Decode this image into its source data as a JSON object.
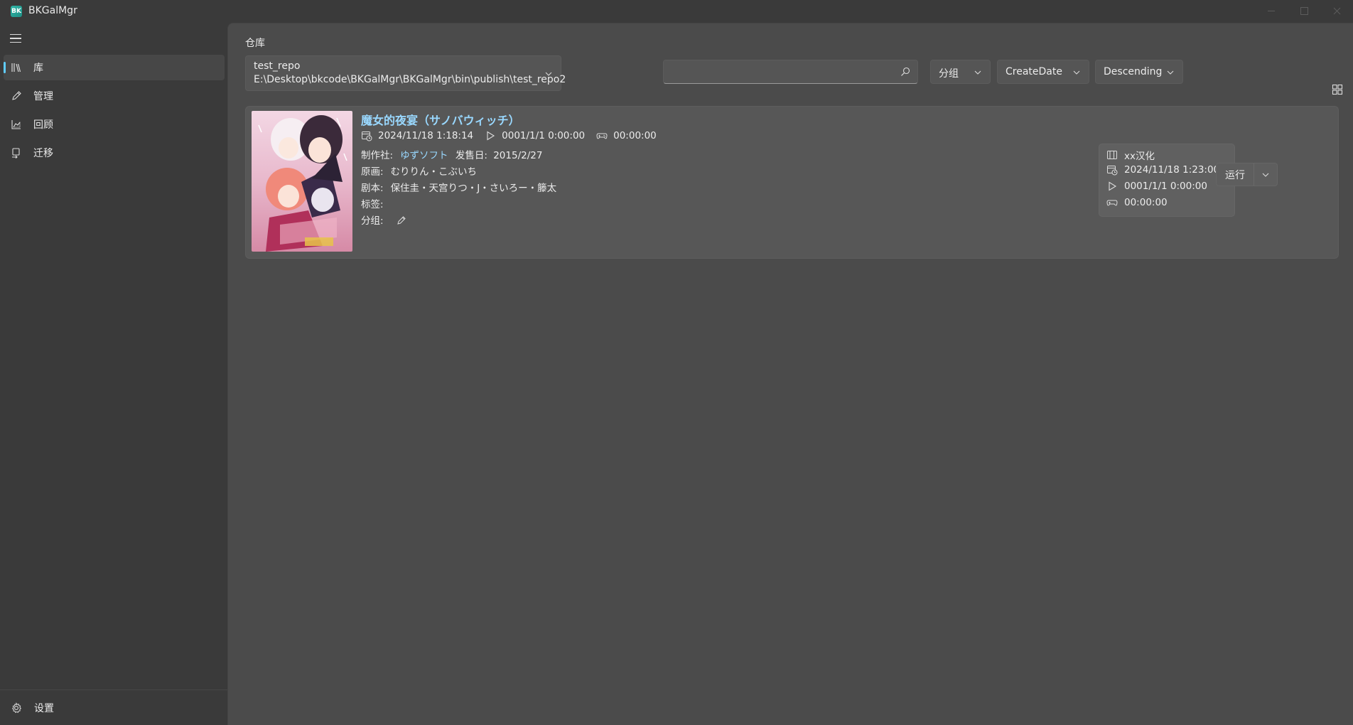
{
  "titlebar": {
    "app_title": "BKGalMgr",
    "logo_text": "BK"
  },
  "sidebar": {
    "items": [
      {
        "label": "库",
        "icon": "library-icon",
        "selected": true
      },
      {
        "label": "管理",
        "icon": "pencil-icon",
        "selected": false
      },
      {
        "label": "回顾",
        "icon": "chart-icon",
        "selected": false
      },
      {
        "label": "迁移",
        "icon": "migrate-icon",
        "selected": false
      }
    ],
    "settings_label": "设置"
  },
  "main": {
    "section_title": "仓库",
    "repo": {
      "name": "test_repo",
      "path": "E:\\Desktop\\bkcode\\BKGalMgr\\BKGalMgr\\bin\\publish\\test_repo2"
    },
    "search": {
      "value": "",
      "placeholder": ""
    },
    "group_dropdown": "分组",
    "sort_field_dropdown": "CreateDate",
    "sort_order_dropdown": "Descending",
    "games": [
      {
        "title": "魔女的夜宴（サノバウィッチ）",
        "created": "2024/11/18 1:18:14",
        "last_played": "0001/1/1 0:00:00",
        "play_time": "00:00:00",
        "maker_label": "制作社:",
        "maker": "ゆずソフト",
        "release_label": "发售日:",
        "release_date": "2015/2/27",
        "artist_label": "原画:",
        "artist": "むりりん・こぶいち",
        "writer_label": "剧本:",
        "writer": "保住圭・天宫りつ・J・さいろー・籐太",
        "tags_label": "标签:",
        "group_label": "分组:",
        "version": {
          "name": "xx汉化",
          "created": "2024/11/18 1:23:00",
          "last_played": "0001/1/1 0:00:00",
          "play_time": "00:00:00"
        },
        "run_label": "运行"
      }
    ]
  },
  "colors": {
    "accent": "#60cdff",
    "link": "#99d8ff",
    "content_bg": "#4b4b4b",
    "sidebar_bg": "#3a3a3a",
    "card_bg": "#575757"
  }
}
